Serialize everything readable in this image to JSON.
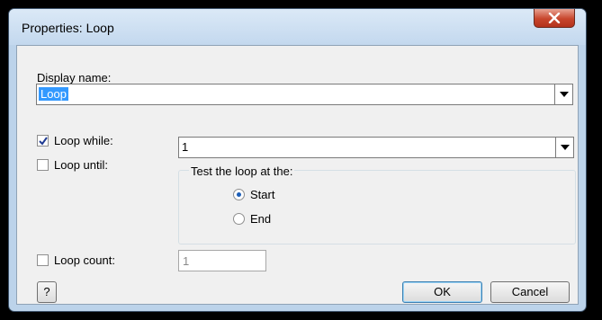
{
  "window": {
    "title": "Properties: Loop"
  },
  "display_name": {
    "label": "Display name:",
    "value": "Loop"
  },
  "loop_while": {
    "label": "Loop while:",
    "checked": true,
    "value": "1"
  },
  "loop_until": {
    "label": "Loop until:",
    "checked": false
  },
  "test_group": {
    "title": "Test the loop at the:",
    "options": [
      {
        "label": "Start",
        "selected": true
      },
      {
        "label": "End",
        "selected": false
      }
    ]
  },
  "loop_count": {
    "label": "Loop count:",
    "checked": false,
    "value": "1"
  },
  "buttons": {
    "help": "?",
    "ok": "OK",
    "cancel": "Cancel"
  },
  "colors": {
    "selection": "#3399ff",
    "close": "#c7452c",
    "radio_dot": "#1d5fb8"
  },
  "icons": {
    "close": "x-icon",
    "dropdown": "chevron-down-icon",
    "check": "checkmark-icon"
  }
}
